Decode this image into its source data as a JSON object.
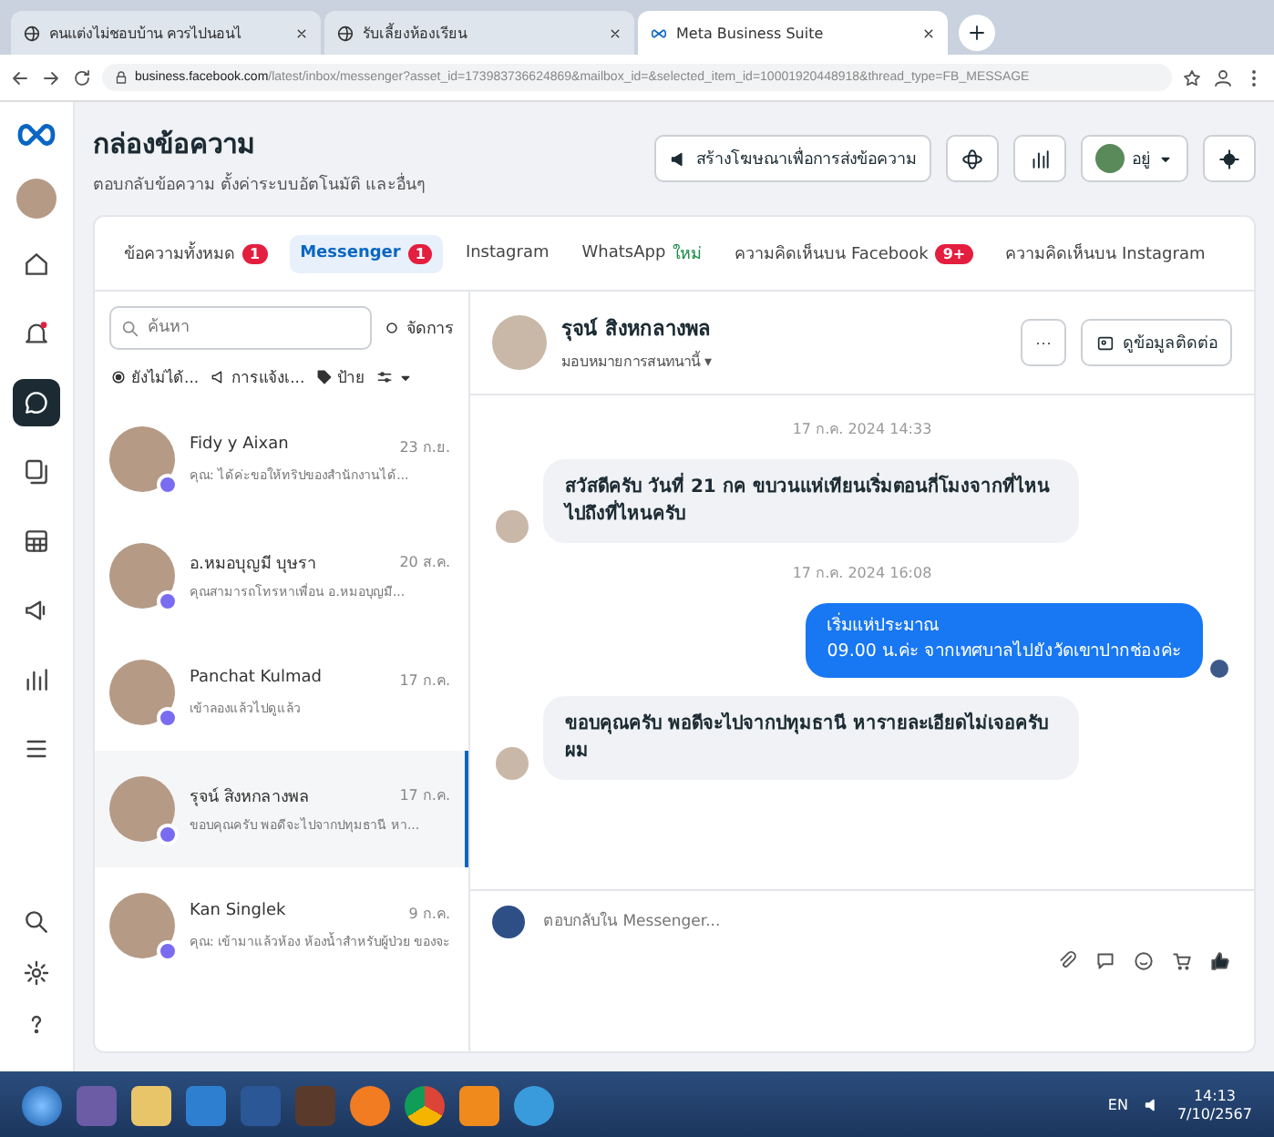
{
  "browser": {
    "tabs": [
      {
        "title": "คนแต่งไม่ชอบบ้าน ควรไปนอนไ",
        "selected": false
      },
      {
        "title": "รับเลี้ยงห้องเรียน",
        "selected": false
      },
      {
        "title": "Meta Business Suite",
        "selected": true
      }
    ],
    "url_host": "business.facebook.com",
    "url_path": "/latest/inbox/messenger?asset_id=173983736624869&mailbox_id=&selected_item_id=10001920448918&thread_type=FB_MESSAGE"
  },
  "nav_items": [
    {
      "kind": "home",
      "selected": false
    },
    {
      "kind": "bell",
      "selected": false
    },
    {
      "kind": "inbox",
      "selected": true
    },
    {
      "kind": "pages",
      "selected": false
    },
    {
      "kind": "grid",
      "selected": false
    },
    {
      "kind": "megaphone",
      "selected": false
    },
    {
      "kind": "chart",
      "selected": false
    },
    {
      "kind": "menu",
      "selected": false
    }
  ],
  "header": {
    "title": "กล่องข้อความ",
    "subtitle": "ตอบกลับข้อความ ตั้งค่าระบบอัตโนมัติ และอื่นๆ",
    "ad_button": "สร้างโฆษณาเพื่อการส่งข้อความ",
    "account_label": "อยู่"
  },
  "inbox_tabs": [
    {
      "label": "ข้อความทั้งหมด",
      "badge": "1",
      "selected": false
    },
    {
      "label": "Messenger",
      "badge": "1",
      "selected": true
    },
    {
      "label": "Instagram",
      "selected": false
    },
    {
      "label": "WhatsApp",
      "tag": "ใหม่",
      "selected": false
    },
    {
      "label": "ความคิดเห็นบน Facebook",
      "badge": "9+",
      "selected": false
    },
    {
      "label": "ความคิดเห็นบน Instagram",
      "selected": false
    }
  ],
  "search": {
    "placeholder": "ค้นหา"
  },
  "manage_label": "จัดการ",
  "filters": [
    {
      "kind": "unread",
      "label": "ยังไม่ได้..."
    },
    {
      "kind": "ads",
      "label": "การแจ้งเ..."
    },
    {
      "kind": "tag",
      "label": "ป้าย"
    },
    {
      "kind": "sort"
    }
  ],
  "conversations": [
    {
      "name": "Fidy y Aixan",
      "time": "23 ก.ย.",
      "preview": "คุณ: ได้ค่ะขอให้ทริปของสำนักงานได้...",
      "selected": false
    },
    {
      "name": "อ.หมอบุญมี บุษรา",
      "time": "20 ส.ค.",
      "preview": "คุณสามารถโทรหาเพื่อน อ.หมอบุญมี...",
      "selected": false
    },
    {
      "name": "Panchat Kulmad",
      "time": "17 ก.ค.",
      "preview": "เข้าลองแล้วไปดูแล้ว",
      "selected": false
    },
    {
      "name": "รุจน์ สิงหกลางพล",
      "time": "17 ก.ค.",
      "preview": "ขอบคุณครับ พอดีจะไปจากปทุมธานี หา...",
      "selected": true
    },
    {
      "name": "Kan Singlek",
      "time": "9 ก.ค.",
      "preview": "คุณ: เข้ามาแล้วห้อง ห้องน้ำสำหรับผู้ป่วย ของจะ",
      "selected": false
    }
  ],
  "chat": {
    "name": "รุจน์ สิงหกลางพล",
    "assign": "มอบหมายการสนทนานี้ ▾",
    "more": "···",
    "contact_button": "ดูข้อมูลติดต่อ",
    "items": [
      {
        "kind": "time",
        "text": "17 ก.ค. 2024 14:33"
      },
      {
        "kind": "in",
        "text": "สวัสดีครับ วันที่ 21 กค ขบวนแห่เทียนเริ่มตอนกี่โมงจากที่ไหนไปถึงที่ไหนครับ"
      },
      {
        "kind": "time",
        "text": "17 ก.ค. 2024 16:08"
      },
      {
        "kind": "out",
        "lines": [
          "เริ่มแห่ประมาณ",
          "09.00 น.ค่ะ จากเทศบาลไปยังวัดเขาปากช่องค่ะ"
        ]
      },
      {
        "kind": "in",
        "text": "ขอบคุณครับ พอดีจะไปจากปทุมธานี หารายละเอียดไม่เจอครับผม"
      }
    ],
    "composer_placeholder": "ตอบกลับใน Messenger..."
  },
  "taskbar": {
    "language": "EN",
    "time": "14:13",
    "date": "7/10/2567"
  }
}
